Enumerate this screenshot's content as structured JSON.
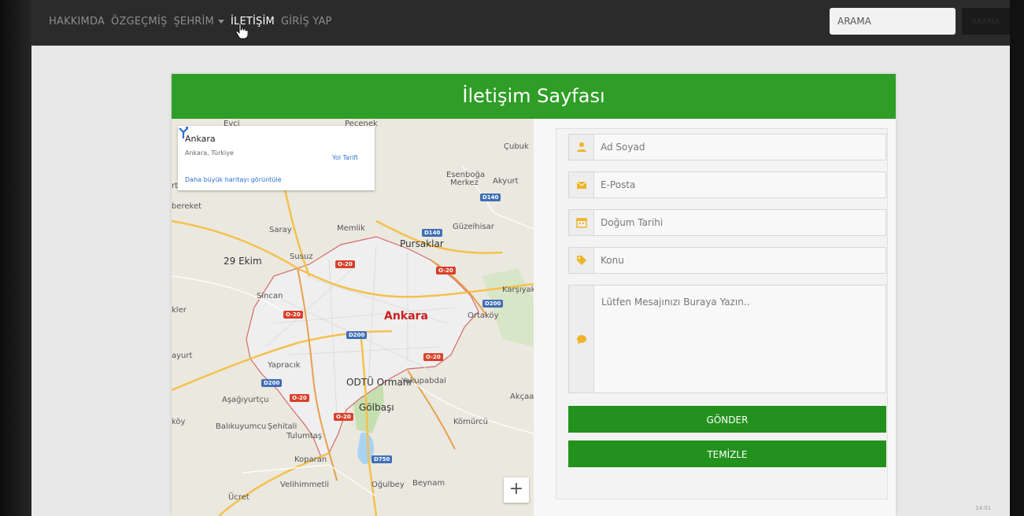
{
  "nav": {
    "items": [
      "HAKKIMDA",
      "ÖZGEÇMİŞ",
      "ŞEHRİM",
      "İLETİŞİM",
      "GİRİŞ YAP"
    ],
    "active": "İLETİŞİM",
    "search_placeholder": "ARAMA",
    "search_button": "ARAMA"
  },
  "page": {
    "title": "İletişim Sayfası",
    "accent_color": "#2e9e26",
    "button_color": "#23911d"
  },
  "map": {
    "place_name": "Ankara",
    "place_sub": "Ankara, Türkiye",
    "directions_label": "Yol Tarifi",
    "larger_map_link": "Daha büyük haritayı görüntüle",
    "zoom_in": "+",
    "labels": {
      "evci": "Evci",
      "pecenek": "Peçenek",
      "cubuk": "Çubuk",
      "esenboga": "Esenboğa",
      "merkez": "Merkez",
      "akyurt": "Akyurt",
      "bereket": "bereket",
      "saray": "Saray",
      "memlik": "Memlik",
      "guzelhisar": "Güzelhisar",
      "pursaklar": "Pursaklar",
      "yirmidokuz_ekim": "29 Ekim",
      "susuz": "Susuz",
      "karsiyaka": "Karşıyak",
      "sincan": "Sincan",
      "kler": "kler",
      "ankara": "Ankara",
      "ortakoy": "Ortaköy",
      "ayurt": "ayurt",
      "yapracik": "Yapracık",
      "odtu_ormani": "ODTÜ Ormanı",
      "yakupabdal": "Yakupabdal",
      "asagiyurtcu": "Aşağıyurtçu",
      "akcaal": "Akçaal",
      "koy": "köy",
      "golbasi": "Gölbaşı",
      "balikuyumcu": "Balıkuyumcu",
      "sehitali": "Şehitali",
      "komurcu": "Kömürcü",
      "tulumtas": "Tulumtaş",
      "koparan": "Koparan",
      "velihimmetli": "Velihimmetli",
      "ogulbey": "Oğulbey",
      "beynam": "Beynam",
      "ucret": "Ücret",
      "rti": "rtı"
    },
    "road_badges": {
      "d140_a": "D140",
      "d140_b": "D140",
      "o20_a": "O-20",
      "o20_b": "O-20",
      "o20_c": "O-20",
      "o20_d": "O-20",
      "o20_e": "O-20",
      "o20_f": "O-20",
      "d200_a": "D200",
      "d200_b": "D200",
      "d200_c": "D200",
      "d750": "D750"
    }
  },
  "form": {
    "name_placeholder": "Ad Soyad",
    "email_placeholder": "E-Posta",
    "birthdate_placeholder": "Doğum Tarihi",
    "subject_placeholder": "Konu",
    "message_placeholder": "Lütfen Mesajınızı Buraya Yazın..",
    "submit_label": "GÖNDER",
    "clear_label": "TEMİZLE",
    "icon_color": "#f0b429"
  },
  "system": {
    "clock": "14:01"
  }
}
